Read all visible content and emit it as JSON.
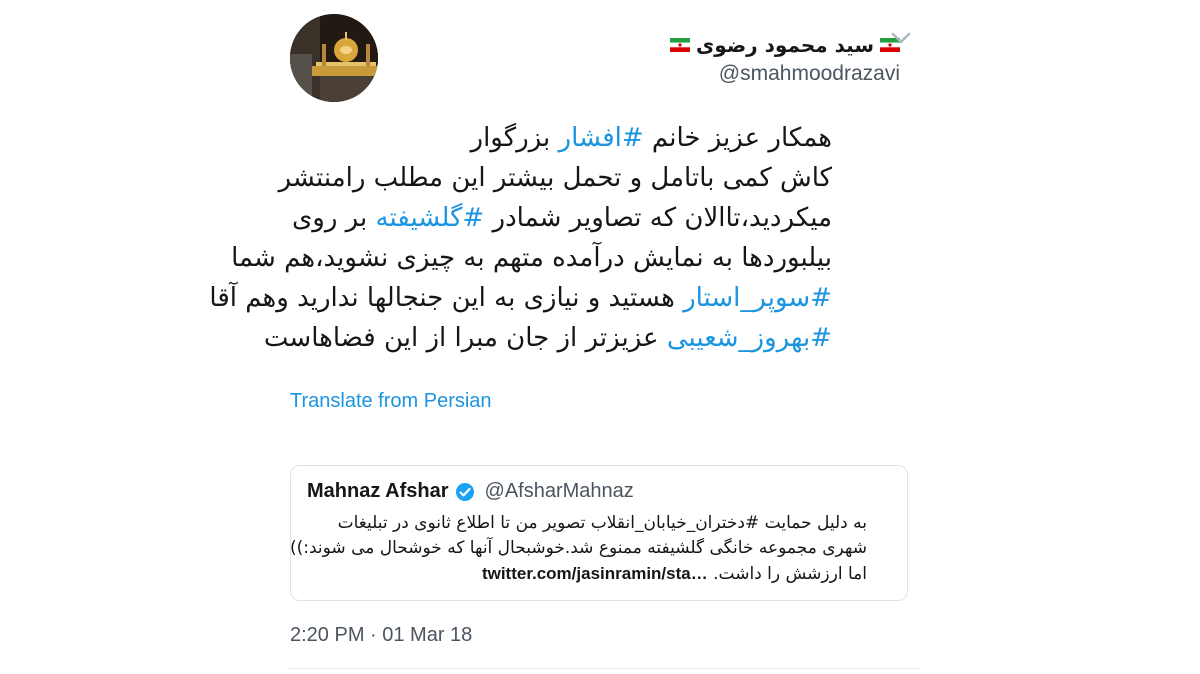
{
  "author": {
    "display_name": "سید محمود رضوی",
    "handle": "@smahmoodrazavi"
  },
  "tweet": {
    "lines": [
      [
        {
          "t": "همکار عزیز خانم "
        },
        {
          "t": "#افشار",
          "tag": true
        },
        {
          "t": " بزرگوار"
        }
      ],
      [
        {
          "t": "کاش کمی باتامل و تحمل بیشتر این مطلب رامنتشر"
        }
      ],
      [
        {
          "t": "میکردید،تاالان که تصاویر شمادر "
        },
        {
          "t": "#گلشیفته",
          "tag": true
        },
        {
          "t": " بر روی"
        }
      ],
      [
        {
          "t": "بیلبوردها به نمایش درآمده متهم به چیزی نشوید،هم شما"
        }
      ],
      [
        {
          "t": "#سوپر_استار",
          "tag": true
        },
        {
          "t": " هستید و نیازی به این جنجالها ندارید وهم آقا"
        }
      ],
      [
        {
          "t": "#بهروز_شعیبی",
          "tag": true
        },
        {
          "t": " عزیزتر از جان مبرا از این فضاهاست"
        }
      ]
    ]
  },
  "translate_label": "Translate from Persian",
  "quoted": {
    "name": "Mahnaz Afshar",
    "handle": "@AfsharMahnaz",
    "lines": [
      [
        {
          "t": "به دلیل حمایت #دختران_خیابان_انقلاب تصویر من تا اطلاع ثانوی در تبلیغات"
        }
      ],
      [
        {
          "t": "شهری مجموعه خانگی گلشیفته ممنوع شد.خوشبحال آنها که خوشحال می شوند:))"
        }
      ],
      [
        {
          "t": "اما ارزشش را داشت. "
        },
        {
          "t": "twitter.com/jasinramin/sta…",
          "link": true
        }
      ]
    ]
  },
  "timestamp": "2:20 PM · 01 Mar 18",
  "colors": {
    "accent": "#1b95e0",
    "text": "#14171a",
    "muted": "#4a5560",
    "border": "#dfe3e6"
  }
}
